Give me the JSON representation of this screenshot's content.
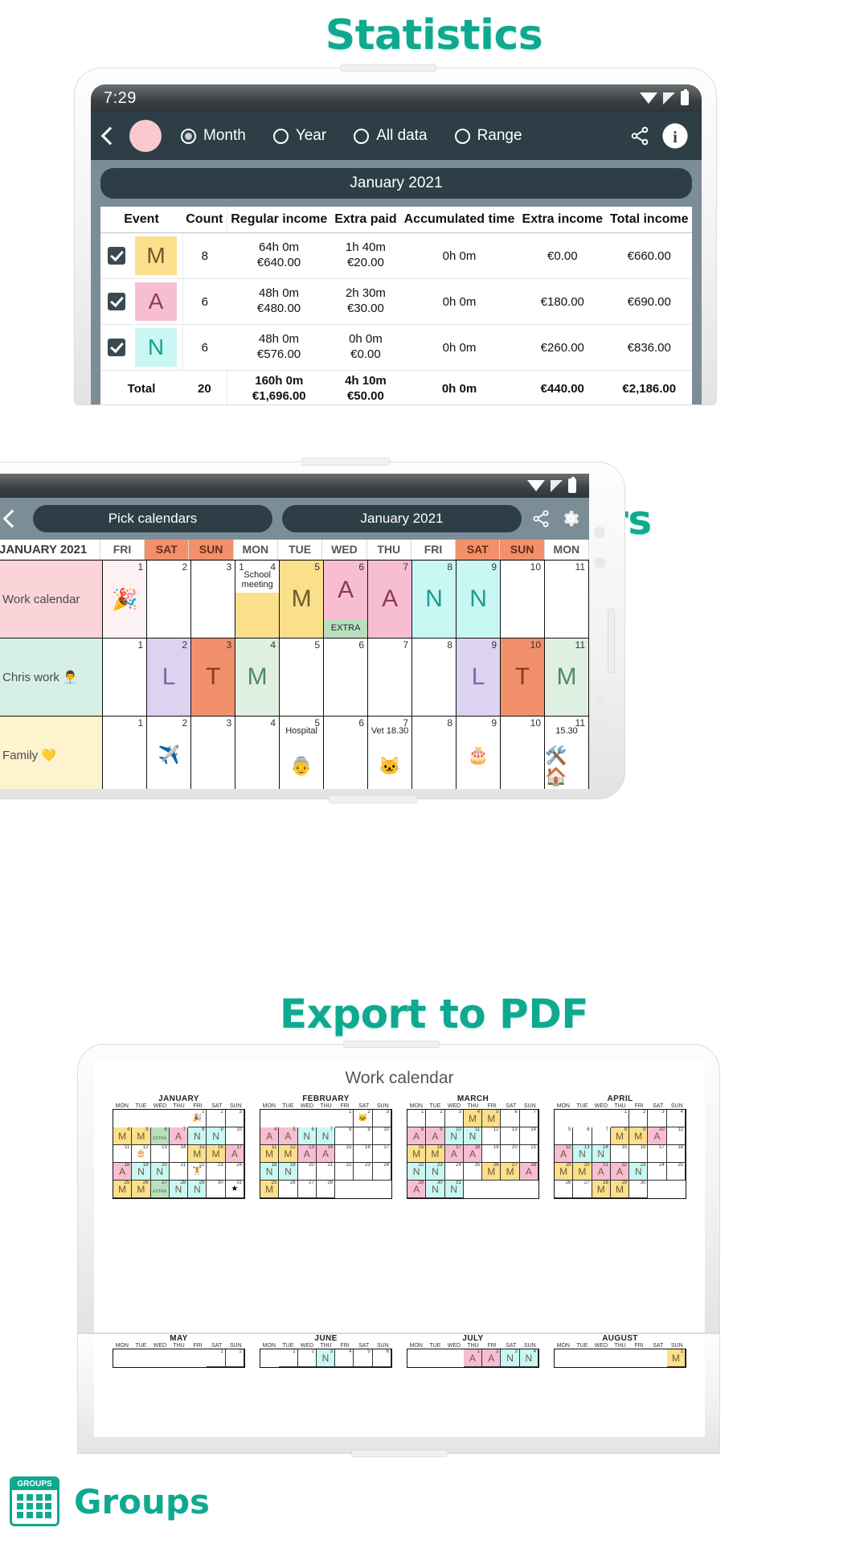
{
  "sections": {
    "statistics_title": "Statistics",
    "compare_title": "Compare Calendars",
    "export_title": "Export to PDF"
  },
  "footer": {
    "brand": "Groups",
    "logo_caption": "GROUPS"
  },
  "statistics_screen": {
    "status": {
      "time": "7:29",
      "wifi_icon": "wifi-icon",
      "signal_icon": "signal-icon",
      "battery_icon": "battery-icon"
    },
    "appbar": {
      "back_icon": "back-chevron-icon",
      "avatar": "avatar",
      "share_icon": "share-icon",
      "info_icon": "info-icon",
      "radios": [
        {
          "label": "Month",
          "selected": true
        },
        {
          "label": "Year",
          "selected": false
        },
        {
          "label": "All data",
          "selected": false
        },
        {
          "label": "Range",
          "selected": false
        }
      ]
    },
    "period_label": "January 2021",
    "table": {
      "columns": [
        "Event",
        "Count",
        "Regular income",
        "Extra paid",
        "Accumulated time",
        "Extra income",
        "Total income"
      ],
      "rows": [
        {
          "checked": true,
          "letter": "M",
          "color": "#fbdf8b",
          "text_color": "#6d5a2a",
          "count": "8",
          "regular_time": "64h 0m",
          "regular_money": "€640.00",
          "extra_time": "1h 40m",
          "extra_money": "€20.00",
          "accumulated": "0h 0m",
          "extra_income": "€0.00",
          "total_income": "€660.00"
        },
        {
          "checked": true,
          "letter": "A",
          "color": "#f7bed2",
          "text_color": "#8b3a57",
          "count": "6",
          "regular_time": "48h 0m",
          "regular_money": "€480.00",
          "extra_time": "2h 30m",
          "extra_money": "€30.00",
          "accumulated": "0h 0m",
          "extra_income": "€180.00",
          "total_income": "€690.00"
        },
        {
          "checked": true,
          "letter": "N",
          "color": "#c9f7f4",
          "text_color": "#17a08e",
          "count": "6",
          "regular_time": "48h 0m",
          "regular_money": "€576.00",
          "extra_time": "0h 0m",
          "extra_money": "€0.00",
          "accumulated": "0h 0m",
          "extra_income": "€260.00",
          "total_income": "€836.00"
        }
      ],
      "total": {
        "label": "Total",
        "count": "20",
        "regular_time": "160h 0m",
        "regular_money": "€1,696.00",
        "extra_time": "4h 10m",
        "extra_money": "€50.00",
        "accumulated": "0h 0m",
        "extra_income": "€440.00",
        "total_income": "€2,186.00"
      }
    }
  },
  "compare_screen": {
    "status": {
      "wifi_icon": "wifi-icon",
      "signal_icon": "signal-icon",
      "battery_icon": "battery-icon"
    },
    "appbar": {
      "back_icon": "back-chevron-icon",
      "pick_calendars": "Pick calendars",
      "month": "January 2021",
      "share_icon": "share-icon",
      "settings_icon": "gear-icon"
    },
    "header": {
      "title": "JANUARY 2021",
      "days": [
        {
          "label": "FRI",
          "weekend": false
        },
        {
          "label": "SAT",
          "weekend": true
        },
        {
          "label": "SUN",
          "weekend": true
        },
        {
          "label": "MON",
          "weekend": false
        },
        {
          "label": "TUE",
          "weekend": false
        },
        {
          "label": "WED",
          "weekend": false
        },
        {
          "label": "THU",
          "weekend": false
        },
        {
          "label": "FRI",
          "weekend": false
        },
        {
          "label": "SAT",
          "weekend": true
        },
        {
          "label": "SUN",
          "weekend": true
        },
        {
          "label": "MON",
          "weekend": false
        }
      ]
    },
    "rows": [
      {
        "name": "Work calendar",
        "name_bg": "#fbd4d9",
        "cells": [
          {
            "day": "1",
            "bg": "#fdf2f3",
            "emoji": "🎉"
          },
          {
            "day": "2",
            "bg": "#ffffff"
          },
          {
            "day": "3",
            "bg": "#ffffff"
          },
          {
            "day": "4",
            "bg": "#fbdf8b",
            "note": "School meeting",
            "left_num": "1"
          },
          {
            "day": "5",
            "bg": "#fbdf8b",
            "letter": "M",
            "letter_color": "#6d5a2a"
          },
          {
            "day": "6",
            "bg": "#f7bed2",
            "letter": "A",
            "letter_color": "#8b3a57",
            "extra": "EXTRA"
          },
          {
            "day": "7",
            "bg": "#f7bed2",
            "letter": "A",
            "letter_color": "#8b3a57"
          },
          {
            "day": "8",
            "bg": "#c9f7f4",
            "letter": "N",
            "letter_color": "#17a08e"
          },
          {
            "day": "9",
            "bg": "#c9f7f4",
            "letter": "N",
            "letter_color": "#17a08e"
          },
          {
            "day": "10",
            "bg": "#ffffff"
          },
          {
            "day": "11",
            "bg": "#ffffff"
          }
        ]
      },
      {
        "name": "Chris work 👨‍💼",
        "name_bg": "#d6f0e6",
        "cells": [
          {
            "day": "1",
            "bg": "#ffffff"
          },
          {
            "day": "2",
            "bg": "#ddd2ef",
            "letter": "L",
            "letter_color": "#7a6aa8"
          },
          {
            "day": "3",
            "bg": "#f2906b",
            "letter": "T",
            "letter_color": "#8d3a1c"
          },
          {
            "day": "4",
            "bg": "#dff0e2",
            "letter": "M",
            "letter_color": "#4e8a64"
          },
          {
            "day": "5",
            "bg": "#ffffff"
          },
          {
            "day": "6",
            "bg": "#ffffff"
          },
          {
            "day": "7",
            "bg": "#ffffff"
          },
          {
            "day": "8",
            "bg": "#ffffff"
          },
          {
            "day": "9",
            "bg": "#ddd2ef",
            "letter": "L",
            "letter_color": "#7a6aa8"
          },
          {
            "day": "10",
            "bg": "#f2906b",
            "letter": "T",
            "letter_color": "#8d3a1c"
          },
          {
            "day": "11",
            "bg": "#dff0e2",
            "letter": "M",
            "letter_color": "#4e8a64"
          }
        ]
      },
      {
        "name": "Family 💛",
        "name_bg": "#fdf3cf",
        "cells": [
          {
            "day": "1",
            "bg": "#ffffff"
          },
          {
            "day": "2",
            "bg": "#ffffff",
            "emoji": "✈️"
          },
          {
            "day": "3",
            "bg": "#ffffff"
          },
          {
            "day": "4",
            "bg": "#ffffff"
          },
          {
            "day": "5",
            "bg": "#ffffff",
            "note": "Hospital",
            "emoji": "👵"
          },
          {
            "day": "6",
            "bg": "#ffffff"
          },
          {
            "day": "7",
            "bg": "#ffffff",
            "note": "Vet 18.30",
            "emoji": "🐱"
          },
          {
            "day": "8",
            "bg": "#ffffff"
          },
          {
            "day": "9",
            "bg": "#ffffff",
            "emoji": "🎂"
          },
          {
            "day": "10",
            "bg": "#ffffff"
          },
          {
            "day": "11",
            "bg": "#ffffff",
            "note": "15.30",
            "emoji": "🛠️🏠"
          }
        ]
      }
    ]
  },
  "export_screen": {
    "title": "Work calendar",
    "dow": [
      "MON",
      "TUE",
      "WED",
      "THU",
      "FRI",
      "SAT",
      "SUN"
    ],
    "months_row1": [
      "JANUARY",
      "FEBRUARY",
      "MARCH",
      "APRIL"
    ],
    "months_row2": [
      "MAY",
      "JUNE",
      "JULY",
      "AUGUST"
    ],
    "legend_colors": {
      "M": "#fbdf8b",
      "A": "#f7bed2",
      "N": "#c9f7f4",
      "EXTRA": "#b9e0bd"
    },
    "january": [
      {
        "n": "",
        "e": true
      },
      {
        "n": "",
        "e": true
      },
      {
        "n": "",
        "e": true
      },
      {
        "n": "",
        "e": true
      },
      {
        "n": "1",
        "bg": "#ffffff",
        "emoji": "🎉"
      },
      {
        "n": "2",
        "bg": "#ffffff"
      },
      {
        "n": "3",
        "bg": "#ffffff"
      },
      {
        "n": "4",
        "bg": "#fbdf8b",
        "t": "M"
      },
      {
        "n": "5",
        "bg": "#fbdf8b",
        "t": "M"
      },
      {
        "n": "6",
        "bg": "#b9e0bd",
        "t": "EXTRA"
      },
      {
        "n": "7",
        "bg": "#f7bed2",
        "t": "A"
      },
      {
        "n": "8",
        "bg": "#c9f7f4",
        "t": "N"
      },
      {
        "n": "9",
        "bg": "#c9f7f4",
        "t": "N"
      },
      {
        "n": "10",
        "bg": "#ffffff"
      },
      {
        "n": "11",
        "bg": "#ffffff"
      },
      {
        "n": "12",
        "bg": "#ffffff",
        "emoji": "🎂"
      },
      {
        "n": "13",
        "bg": "#ffffff"
      },
      {
        "n": "14",
        "bg": "#ffffff"
      },
      {
        "n": "15",
        "bg": "#fbdf8b",
        "t": "M"
      },
      {
        "n": "16",
        "bg": "#fbdf8b",
        "t": "M"
      },
      {
        "n": "17",
        "bg": "#f7bed2",
        "t": "A"
      },
      {
        "n": "18",
        "bg": "#f7bed2",
        "t": "A"
      },
      {
        "n": "19",
        "bg": "#c9f7f4",
        "t": "N"
      },
      {
        "n": "20",
        "bg": "#c9f7f4",
        "t": "N"
      },
      {
        "n": "21",
        "bg": "#ffffff"
      },
      {
        "n": "22",
        "bg": "#ffffff",
        "emoji": "🏋️"
      },
      {
        "n": "23",
        "bg": "#ffffff"
      },
      {
        "n": "24",
        "bg": "#ffffff"
      },
      {
        "n": "25",
        "bg": "#fbdf8b",
        "t": "M"
      },
      {
        "n": "26",
        "bg": "#fbdf8b",
        "t": "M"
      },
      {
        "n": "27",
        "bg": "#b9e0bd",
        "t": "EXTRA"
      },
      {
        "n": "28",
        "bg": "#c9f7f4",
        "t": "N"
      },
      {
        "n": "29",
        "bg": "#c9f7f4",
        "t": "N"
      },
      {
        "n": "30",
        "bg": "#ffffff"
      },
      {
        "n": "31",
        "bg": "#ffffff",
        "emoji": "★"
      }
    ],
    "february": [
      {
        "n": "",
        "e": true
      },
      {
        "n": "",
        "e": true
      },
      {
        "n": "",
        "e": true
      },
      {
        "n": "",
        "e": true
      },
      {
        "n": "1",
        "bg": "#ffffff"
      },
      {
        "n": "2",
        "bg": "#ffffff",
        "emoji": "🐱"
      },
      {
        "n": "3",
        "bg": "#ffffff"
      },
      {
        "n": "4",
        "bg": "#f7bed2",
        "t": "A"
      },
      {
        "n": "5",
        "bg": "#f7bed2",
        "t": "A"
      },
      {
        "n": "6",
        "bg": "#c9f7f4",
        "t": "N"
      },
      {
        "n": "7",
        "bg": "#c9f7f4",
        "t": "N"
      },
      {
        "n": "8",
        "bg": "#ffffff"
      },
      {
        "n": "9",
        "bg": "#ffffff"
      },
      {
        "n": "10",
        "bg": "#ffffff"
      },
      {
        "n": "11",
        "bg": "#fbdf8b",
        "t": "M"
      },
      {
        "n": "12",
        "bg": "#fbdf8b",
        "t": "M"
      },
      {
        "n": "13",
        "bg": "#f7bed2",
        "t": "A"
      },
      {
        "n": "14",
        "bg": "#f7bed2",
        "t": "A"
      },
      {
        "n": "15",
        "bg": "#ffffff"
      },
      {
        "n": "16",
        "bg": "#ffffff"
      },
      {
        "n": "17",
        "bg": "#ffffff"
      },
      {
        "n": "18",
        "bg": "#c9f7f4",
        "t": "N"
      },
      {
        "n": "19",
        "bg": "#c9f7f4",
        "t": "N"
      },
      {
        "n": "20",
        "bg": "#ffffff"
      },
      {
        "n": "21",
        "bg": "#ffffff"
      },
      {
        "n": "22",
        "bg": "#ffffff"
      },
      {
        "n": "23",
        "bg": "#ffffff"
      },
      {
        "n": "24",
        "bg": "#ffffff"
      },
      {
        "n": "25",
        "bg": "#fbdf8b",
        "t": "M"
      },
      {
        "n": "26",
        "bg": "#ffffff"
      },
      {
        "n": "27",
        "bg": "#ffffff"
      },
      {
        "n": "28",
        "bg": "#ffffff"
      }
    ],
    "march": [
      {
        "n": "1",
        "bg": "#ffffff"
      },
      {
        "n": "2",
        "bg": "#ffffff"
      },
      {
        "n": "3",
        "bg": "#ffffff"
      },
      {
        "n": "4",
        "bg": "#fbdf8b",
        "t": "M"
      },
      {
        "n": "5",
        "bg": "#fbdf8b",
        "t": "M"
      },
      {
        "n": "6",
        "bg": "#ffffff"
      },
      {
        "n": "7",
        "bg": "#ffffff"
      },
      {
        "n": "8",
        "bg": "#f7bed2",
        "t": "A"
      },
      {
        "n": "9",
        "bg": "#f7bed2",
        "t": "A"
      },
      {
        "n": "10",
        "bg": "#c9f7f4",
        "t": "N"
      },
      {
        "n": "11",
        "bg": "#c9f7f4",
        "t": "N"
      },
      {
        "n": "12",
        "bg": "#ffffff"
      },
      {
        "n": "13",
        "bg": "#ffffff"
      },
      {
        "n": "14",
        "bg": "#ffffff"
      },
      {
        "n": "15",
        "bg": "#fbdf8b",
        "t": "M"
      },
      {
        "n": "16",
        "bg": "#fbdf8b",
        "t": "M"
      },
      {
        "n": "17",
        "bg": "#f7bed2",
        "t": "A"
      },
      {
        "n": "18",
        "bg": "#f7bed2",
        "t": "A"
      },
      {
        "n": "19",
        "bg": "#ffffff"
      },
      {
        "n": "20",
        "bg": "#ffffff"
      },
      {
        "n": "21",
        "bg": "#ffffff"
      },
      {
        "n": "22",
        "bg": "#c9f7f4",
        "t": "N"
      },
      {
        "n": "23",
        "bg": "#c9f7f4",
        "t": "N"
      },
      {
        "n": "24",
        "bg": "#ffffff"
      },
      {
        "n": "25",
        "bg": "#ffffff"
      },
      {
        "n": "26",
        "bg": "#fbdf8b",
        "t": "M"
      },
      {
        "n": "27",
        "bg": "#fbdf8b",
        "t": "M"
      },
      {
        "n": "28",
        "bg": "#f7bed2",
        "t": "A"
      },
      {
        "n": "29",
        "bg": "#f7bed2",
        "t": "A"
      },
      {
        "n": "30",
        "bg": "#c9f7f4",
        "t": "N"
      },
      {
        "n": "31",
        "bg": "#c9f7f4",
        "t": "N"
      }
    ],
    "april": [
      {
        "n": "",
        "e": true
      },
      {
        "n": "",
        "e": true
      },
      {
        "n": "",
        "e": true
      },
      {
        "n": "1",
        "bg": "#ffffff"
      },
      {
        "n": "2",
        "bg": "#ffffff"
      },
      {
        "n": "3",
        "bg": "#ffffff"
      },
      {
        "n": "4",
        "bg": "#ffffff"
      },
      {
        "n": "5",
        "bg": "#ffffff"
      },
      {
        "n": "6",
        "bg": "#ffffff"
      },
      {
        "n": "7",
        "bg": "#ffffff"
      },
      {
        "n": "8",
        "bg": "#fbdf8b",
        "t": "M"
      },
      {
        "n": "9",
        "bg": "#fbdf8b",
        "t": "M"
      },
      {
        "n": "10",
        "bg": "#f7bed2",
        "t": "A"
      },
      {
        "n": "11",
        "bg": "#ffffff"
      },
      {
        "n": "12",
        "bg": "#f7bed2",
        "t": "A"
      },
      {
        "n": "13",
        "bg": "#c9f7f4",
        "t": "N"
      },
      {
        "n": "14",
        "bg": "#c9f7f4",
        "t": "N"
      },
      {
        "n": "15",
        "bg": "#ffffff"
      },
      {
        "n": "16",
        "bg": "#ffffff"
      },
      {
        "n": "17",
        "bg": "#ffffff"
      },
      {
        "n": "18",
        "bg": "#ffffff"
      },
      {
        "n": "19",
        "bg": "#fbdf8b",
        "t": "M"
      },
      {
        "n": "20",
        "bg": "#fbdf8b",
        "t": "M"
      },
      {
        "n": "21",
        "bg": "#f7bed2",
        "t": "A"
      },
      {
        "n": "22",
        "bg": "#f7bed2",
        "t": "A"
      },
      {
        "n": "23",
        "bg": "#c9f7f4",
        "t": "N"
      },
      {
        "n": "24",
        "bg": "#ffffff"
      },
      {
        "n": "25",
        "bg": "#ffffff"
      },
      {
        "n": "26",
        "bg": "#ffffff"
      },
      {
        "n": "27",
        "bg": "#ffffff"
      },
      {
        "n": "28",
        "bg": "#fbdf8b",
        "t": "M"
      },
      {
        "n": "29",
        "bg": "#fbdf8b",
        "t": "M"
      },
      {
        "n": "30",
        "bg": "#ffffff"
      },
      {
        "n": "",
        "e": true
      },
      {
        "n": "",
        "e": true
      }
    ],
    "may": [
      {
        "n": "",
        "e": true
      },
      {
        "n": "",
        "e": true
      },
      {
        "n": "",
        "e": true
      },
      {
        "n": "",
        "e": true
      },
      {
        "n": "",
        "e": true
      },
      {
        "n": "1",
        "bg": "#ffffff"
      },
      {
        "n": "2",
        "bg": "#ffffff"
      }
    ],
    "june": [
      {
        "n": "",
        "e": true
      },
      {
        "n": "1",
        "bg": "#ffffff"
      },
      {
        "n": "2",
        "bg": "#ffffff"
      },
      {
        "n": "3",
        "bg": "#c9f7f4",
        "t": "N"
      },
      {
        "n": "4",
        "bg": "#ffffff"
      },
      {
        "n": "5",
        "bg": "#ffffff"
      },
      {
        "n": "6",
        "bg": "#ffffff"
      }
    ],
    "july": [
      {
        "n": "",
        "e": true
      },
      {
        "n": "",
        "e": true
      },
      {
        "n": "",
        "e": true
      },
      {
        "n": "1",
        "bg": "#f7bed2",
        "t": "A"
      },
      {
        "n": "2",
        "bg": "#f7bed2",
        "t": "A"
      },
      {
        "n": "3",
        "bg": "#c9f7f4",
        "t": "N"
      },
      {
        "n": "4",
        "bg": "#c9f7f4",
        "t": "N"
      }
    ],
    "august": [
      {
        "n": "",
        "e": true
      },
      {
        "n": "",
        "e": true
      },
      {
        "n": "",
        "e": true
      },
      {
        "n": "",
        "e": true
      },
      {
        "n": "",
        "e": true
      },
      {
        "n": "",
        "e": true
      },
      {
        "n": "1",
        "bg": "#fbdf8b",
        "t": "M"
      }
    ]
  }
}
